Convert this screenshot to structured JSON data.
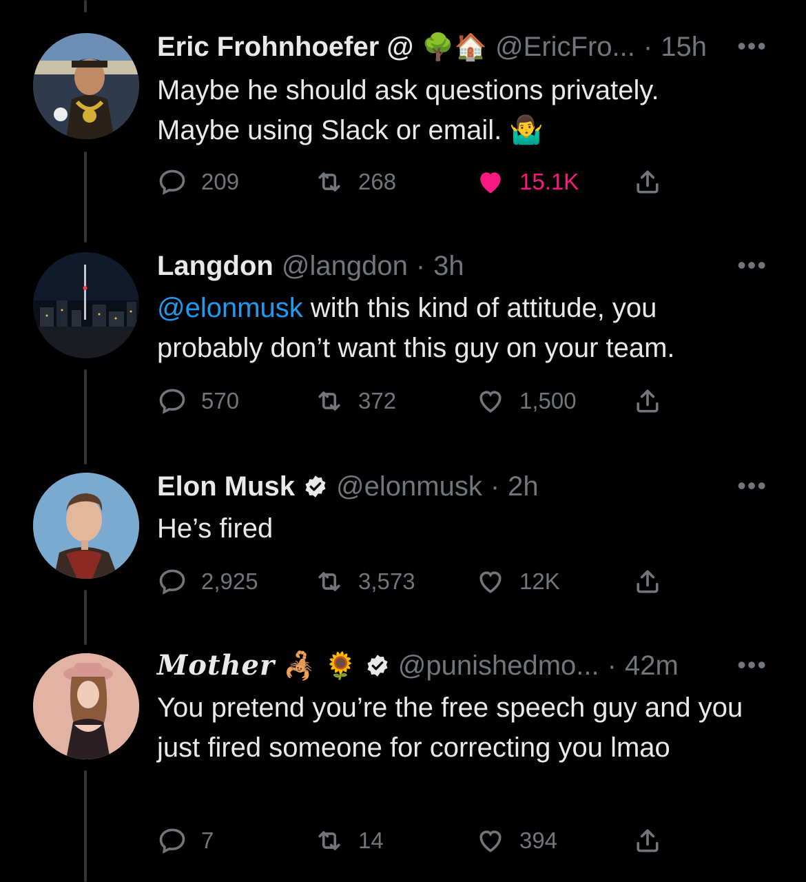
{
  "colors": {
    "background": "#000000",
    "text": "#e7e9ea",
    "muted": "#71767b",
    "mention": "#1d9bf0",
    "like": "#f91880"
  },
  "tweets": [
    {
      "name": "Eric Frohnhoefer @",
      "emoji": "🌳🏠",
      "handle": "@EricFro...",
      "dot": "·",
      "time": "15h",
      "more": "•••",
      "text_lines": [
        "Maybe he should ask questions privately.",
        "Maybe using Slack or email.  🤷‍♂️"
      ],
      "replies": "209",
      "retweets": "268",
      "likes": "15.1K",
      "liked": true,
      "avatar_icon": "avatar-baseball-fan"
    },
    {
      "name": "Langdon",
      "handle": "@langdon",
      "dot": "·",
      "time": "3h",
      "more": "•••",
      "mention": "@elonmusk",
      "text_rest": " with this kind of attitude, you probably don’t want this guy on your team.",
      "replies": "570",
      "retweets": "372",
      "likes": "1,500",
      "liked": false,
      "avatar_icon": "avatar-city-skyline"
    },
    {
      "name": "Elon Musk",
      "verified": true,
      "handle": "@elonmusk",
      "dot": "·",
      "time": "2h",
      "more": "•••",
      "text": "He’s fired",
      "replies": "2,925",
      "retweets": "3,573",
      "likes": "12K",
      "liked": false,
      "avatar_icon": "avatar-portrait"
    },
    {
      "name": "Mother",
      "emoji": "🦂 🌻",
      "verified": true,
      "handle": "@punishedmo...",
      "dot": "·",
      "time": "42m",
      "more": "•••",
      "text": "You pretend you’re the free speech guy and you just fired someone for correcting you lmao",
      "replies": "7",
      "retweets": "14",
      "likes": "394",
      "liked": false,
      "avatar_icon": "avatar-woman-hat"
    }
  ]
}
